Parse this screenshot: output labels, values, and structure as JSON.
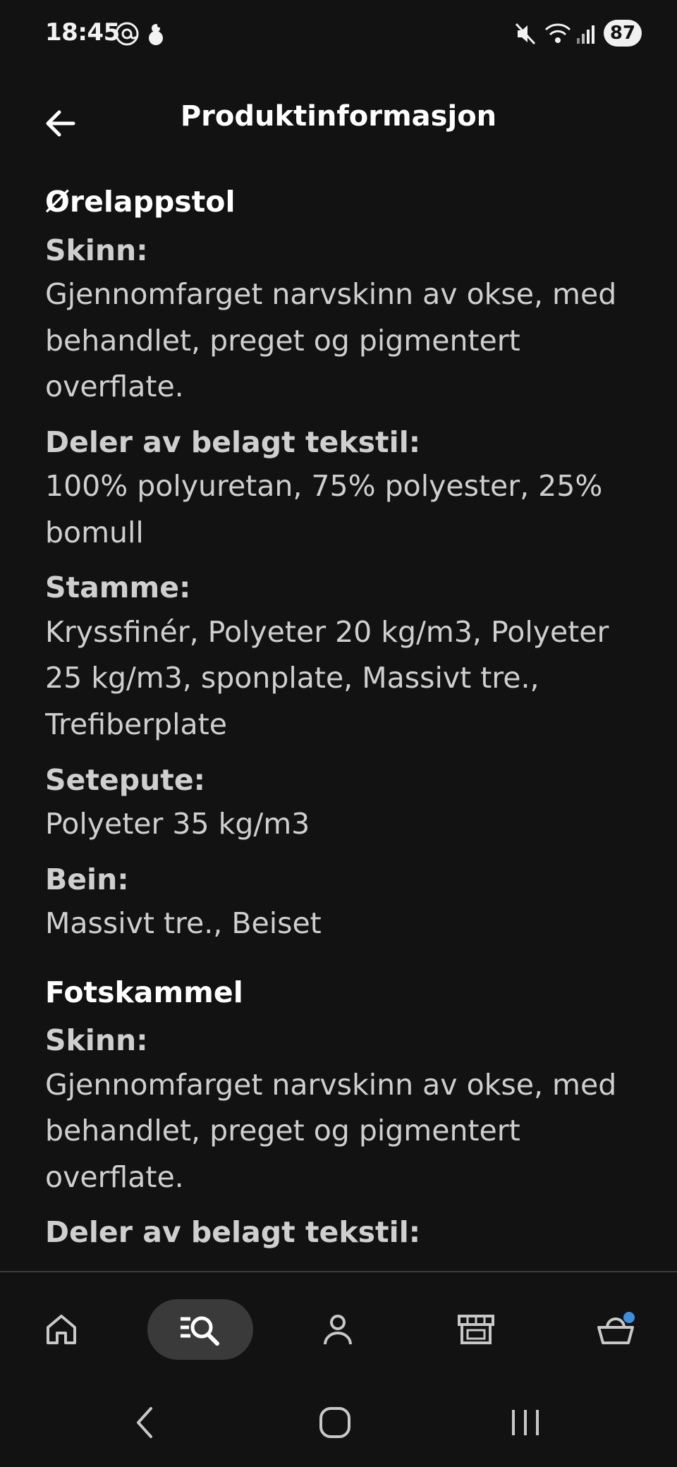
{
  "status_bar": {
    "time": "18:45",
    "battery": "87",
    "icons": [
      "at-sign-icon",
      "notification-icon",
      "mute-icon",
      "wifi-icon",
      "signal-icon"
    ]
  },
  "header": {
    "title": "Produktinformasjon",
    "back_icon": "arrow-left-icon"
  },
  "sections": [
    {
      "title": "Ørelappstol",
      "items": [
        {
          "label": "Skinn:",
          "value": "Gjennomfarget narvskinn av okse, med behandlet, preget og pigmentert overflate."
        },
        {
          "label": "Deler av belagt tekstil:",
          "value": "100% polyuretan, 75% polyester, 25% bomull"
        },
        {
          "label": "Stamme:",
          "value": "Kryssfinér, Polyeter 20 kg/m3, Polyeter 25 kg/m3, sponplate, Massivt tre., Trefiberplate"
        },
        {
          "label": "Setepute:",
          "value": "Polyeter 35 kg/m3"
        },
        {
          "label": "Bein:",
          "value": "Massivt tre., Beiset"
        }
      ]
    },
    {
      "title": "Fotskammel",
      "items": [
        {
          "label": "Skinn:",
          "value": "Gjennomfarget narvskinn av okse, med behandlet, preget og pigmentert overflate."
        },
        {
          "label": "Deler av belagt tekstil:",
          "value": ""
        }
      ]
    }
  ],
  "bottom_nav": {
    "items": [
      {
        "name": "home-icon",
        "active": false
      },
      {
        "name": "search-list-icon",
        "active": true
      },
      {
        "name": "profile-icon",
        "active": false
      },
      {
        "name": "store-icon",
        "active": false
      },
      {
        "name": "basket-icon",
        "active": false,
        "badge_color": "#3b8fe0"
      }
    ]
  },
  "system_nav": {
    "items": [
      "back-chevron-icon",
      "home-circle-icon",
      "recents-icon"
    ]
  },
  "colors": {
    "background": "#121212",
    "text": "#d2d2d2",
    "title": "#ffffff",
    "active_nav": "#3a3a3a",
    "badge": "#3b8fe0"
  }
}
